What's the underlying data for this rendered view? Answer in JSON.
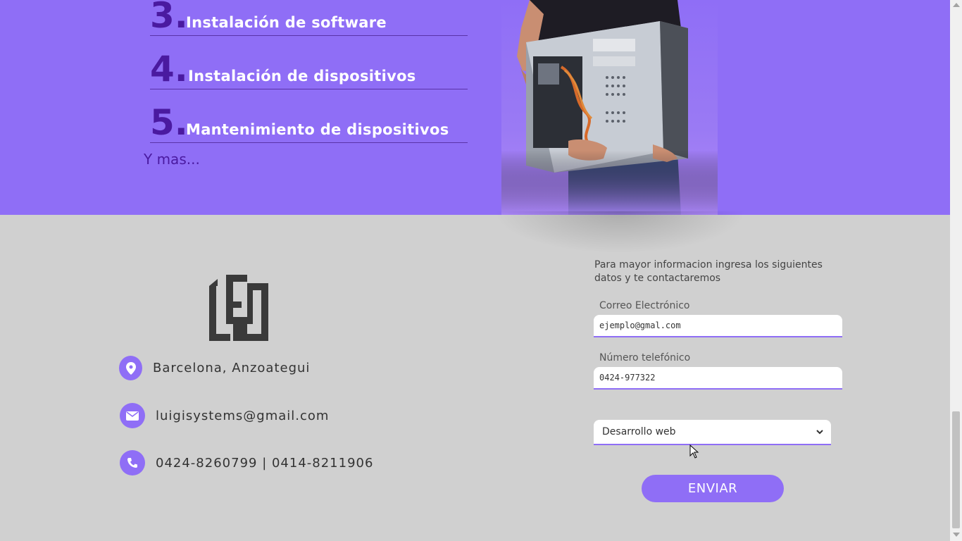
{
  "services": {
    "items": [
      {
        "num": "3.",
        "label": "Instalación de software"
      },
      {
        "num": "4.",
        "label": "Instalación de dispositivos"
      },
      {
        "num": "5.",
        "label": "Mantenimiento de dispositivos"
      }
    ],
    "more": "Y mas..."
  },
  "contact": {
    "location": "Barcelona, Anzoategui",
    "email": "luigisystems@gmail.com",
    "phones": "0424-8260799 | 0414-8211906"
  },
  "form": {
    "intro": "Para mayor informacion ingresa los siguientes datos y te contactaremos",
    "email_label": "Correo Electrónico",
    "email_value": "ejemplo@gmal.com",
    "phone_label": "Número telefónico",
    "phone_value": "0424-977322",
    "service_selected": "Desarrollo web",
    "submit_label": "ENVIAR"
  },
  "colors": {
    "accent": "#8f6ef6",
    "number": "#4a1aa0",
    "footer_bg": "#d0d0d0"
  }
}
